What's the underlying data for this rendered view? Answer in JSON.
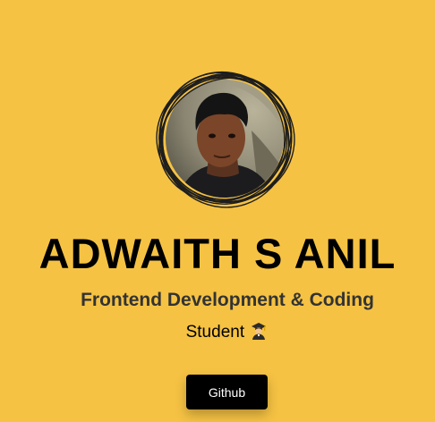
{
  "profile": {
    "name": "ADWAITH S ANIL",
    "tagline": "Frontend Development & Coding",
    "role": "Student",
    "role_icon": "graduate-student-icon",
    "avatar_icon": "profile-photo"
  },
  "actions": {
    "github_label": "Github"
  },
  "colors": {
    "background": "#f5c243",
    "button": "#000000",
    "button_text": "#ffffff",
    "tagline": "#333333"
  }
}
